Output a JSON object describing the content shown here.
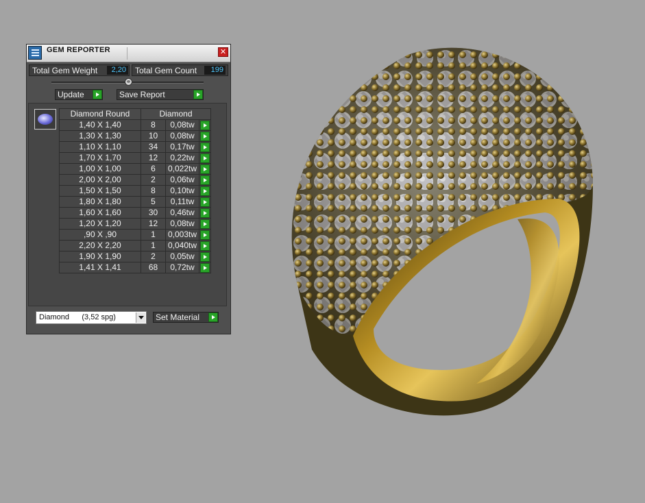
{
  "window": {
    "title": "GEM REPORTER",
    "close_glyph": "✕"
  },
  "stats": {
    "weight_label": "Total Gem Weight",
    "weight_value": "2,20",
    "count_label": "Total Gem Count",
    "count_value": "199"
  },
  "buttons": {
    "update": "Update",
    "save_report": "Save Report",
    "set_material": "Set Material"
  },
  "table": {
    "header_shape": "Diamond Round",
    "header_material": "Diamond",
    "rows": [
      {
        "size": "1,40 X 1,40",
        "count": "8",
        "weight": "0,08tw"
      },
      {
        "size": "1,30 X 1,30",
        "count": "10",
        "weight": "0,08tw"
      },
      {
        "size": "1,10 X 1,10",
        "count": "34",
        "weight": "0,17tw"
      },
      {
        "size": "1,70 X 1,70",
        "count": "12",
        "weight": "0,22tw"
      },
      {
        "size": "1,00 X 1,00",
        "count": "6",
        "weight": "0,022tw"
      },
      {
        "size": "2,00 X 2,00",
        "count": "2",
        "weight": "0,06tw"
      },
      {
        "size": "1,50 X 1,50",
        "count": "8",
        "weight": "0,10tw"
      },
      {
        "size": "1,80 X 1,80",
        "count": "5",
        "weight": "0,11tw"
      },
      {
        "size": "1,60 X 1,60",
        "count": "30",
        "weight": "0,46tw"
      },
      {
        "size": "1,20 X 1,20",
        "count": "12",
        "weight": "0,08tw"
      },
      {
        "size": ",90 X ,90",
        "count": "1",
        "weight": "0,003tw"
      },
      {
        "size": "2,20 X 2,20",
        "count": "1",
        "weight": "0,040tw"
      },
      {
        "size": "1,90 X 1,90",
        "count": "2",
        "weight": "0,05tw"
      },
      {
        "size": "1,41 X 1,41",
        "count": "68",
        "weight": "0,72tw"
      }
    ]
  },
  "material_select": {
    "selected": "Diamond      (3,52 spg)"
  },
  "colors": {
    "viewport_bg": "#a3a3a3",
    "panel_bg": "#4f4f4f",
    "value_text": "#4fc8ff",
    "go_button": "#28a428",
    "close_button": "#c92020"
  }
}
